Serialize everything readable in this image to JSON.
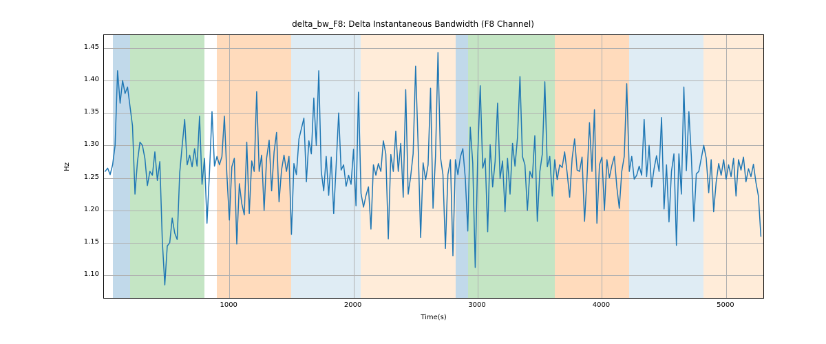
{
  "chart_data": {
    "type": "line",
    "title": "delta_bw_F8: Delta Instantaneous Bandwidth (F8 Channel)",
    "xlabel": "Time(s)",
    "ylabel": "Hz",
    "xlim": [
      -10,
      5300
    ],
    "ylim": [
      1.065,
      1.47
    ],
    "xticks": [
      1000,
      2000,
      3000,
      4000,
      5000
    ],
    "yticks": [
      1.1,
      1.15,
      1.2,
      1.25,
      1.3,
      1.35,
      1.4,
      1.45
    ],
    "bands": [
      {
        "x0": 60,
        "x1": 200,
        "color": "#1f77b4"
      },
      {
        "x0": 200,
        "x1": 800,
        "color": "#2ca02c"
      },
      {
        "x0": 900,
        "x1": 1500,
        "color": "#ff7f0e"
      },
      {
        "x0": 1500,
        "x1": 2060,
        "color": "#1f77b4",
        "alpha": 0.14
      },
      {
        "x0": 2060,
        "x1": 2820,
        "color": "#ffb977"
      },
      {
        "x0": 2820,
        "x1": 2920,
        "color": "#1f77b4"
      },
      {
        "x0": 2920,
        "x1": 3620,
        "color": "#2ca02c"
      },
      {
        "x0": 3620,
        "x1": 4220,
        "color": "#ff7f0e"
      },
      {
        "x0": 4220,
        "x1": 4820,
        "color": "#1f77b4",
        "alpha": 0.14
      },
      {
        "x0": 4820,
        "x1": 5300,
        "color": "#ffb977"
      }
    ],
    "x": [
      0,
      20,
      40,
      60,
      80,
      100,
      120,
      140,
      160,
      180,
      200,
      220,
      240,
      260,
      280,
      300,
      320,
      340,
      360,
      380,
      400,
      420,
      440,
      460,
      480,
      500,
      520,
      540,
      560,
      580,
      600,
      620,
      640,
      660,
      680,
      700,
      720,
      740,
      760,
      780,
      800,
      820,
      840,
      860,
      880,
      900,
      920,
      940,
      960,
      980,
      1000,
      1020,
      1040,
      1060,
      1080,
      1100,
      1120,
      1140,
      1160,
      1180,
      1200,
      1220,
      1240,
      1260,
      1280,
      1300,
      1320,
      1340,
      1360,
      1380,
      1400,
      1420,
      1440,
      1460,
      1480,
      1500,
      1520,
      1540,
      1560,
      1580,
      1600,
      1620,
      1640,
      1660,
      1680,
      1700,
      1720,
      1740,
      1760,
      1780,
      1800,
      1820,
      1840,
      1860,
      1880,
      1900,
      1920,
      1940,
      1960,
      1980,
      2000,
      2020,
      2040,
      2060,
      2080,
      2100,
      2120,
      2140,
      2160,
      2180,
      2200,
      2220,
      2240,
      2260,
      2280,
      2300,
      2320,
      2340,
      2360,
      2380,
      2400,
      2420,
      2440,
      2460,
      2480,
      2500,
      2520,
      2540,
      2560,
      2580,
      2600,
      2620,
      2640,
      2660,
      2680,
      2700,
      2720,
      2740,
      2760,
      2780,
      2800,
      2820,
      2840,
      2860,
      2880,
      2900,
      2920,
      2940,
      2960,
      2980,
      3000,
      3020,
      3040,
      3060,
      3080,
      3100,
      3120,
      3140,
      3160,
      3180,
      3200,
      3220,
      3240,
      3260,
      3280,
      3300,
      3320,
      3340,
      3360,
      3380,
      3400,
      3420,
      3440,
      3460,
      3480,
      3500,
      3520,
      3540,
      3560,
      3580,
      3600,
      3620,
      3640,
      3660,
      3680,
      3700,
      3720,
      3740,
      3760,
      3780,
      3800,
      3820,
      3840,
      3860,
      3880,
      3900,
      3920,
      3940,
      3960,
      3980,
      4000,
      4020,
      4040,
      4060,
      4080,
      4100,
      4120,
      4140,
      4160,
      4180,
      4200,
      4220,
      4240,
      4260,
      4280,
      4300,
      4320,
      4340,
      4360,
      4380,
      4400,
      4420,
      4440,
      4460,
      4480,
      4500,
      4520,
      4540,
      4560,
      4580,
      4600,
      4620,
      4640,
      4660,
      4680,
      4700,
      4720,
      4740,
      4760,
      4780,
      4800,
      4820,
      4840,
      4860,
      4880,
      4900,
      4920,
      4940,
      4960,
      4980,
      5000,
      5020,
      5040,
      5060,
      5080,
      5100,
      5120,
      5140,
      5160,
      5180,
      5200,
      5220,
      5240,
      5260,
      5280
    ],
    "y": [
      1.26,
      1.265,
      1.255,
      1.27,
      1.3,
      1.415,
      1.365,
      1.4,
      1.38,
      1.39,
      1.36,
      1.33,
      1.225,
      1.275,
      1.305,
      1.3,
      1.28,
      1.238,
      1.26,
      1.254,
      1.29,
      1.246,
      1.275,
      1.153,
      1.085,
      1.145,
      1.15,
      1.188,
      1.165,
      1.155,
      1.258,
      1.3,
      1.34,
      1.27,
      1.285,
      1.267,
      1.295,
      1.268,
      1.345,
      1.24,
      1.28,
      1.18,
      1.26,
      1.352,
      1.268,
      1.283,
      1.27,
      1.283,
      1.345,
      1.255,
      1.185,
      1.267,
      1.28,
      1.148,
      1.241,
      1.21,
      1.193,
      1.305,
      1.195,
      1.276,
      1.26,
      1.383,
      1.26,
      1.285,
      1.2,
      1.28,
      1.308,
      1.23,
      1.29,
      1.32,
      1.213,
      1.262,
      1.285,
      1.26,
      1.283,
      1.163,
      1.272,
      1.255,
      1.31,
      1.326,
      1.342,
      1.244,
      1.307,
      1.287,
      1.373,
      1.3,
      1.415,
      1.26,
      1.23,
      1.283,
      1.223,
      1.282,
      1.195,
      1.27,
      1.35,
      1.262,
      1.27,
      1.237,
      1.254,
      1.24,
      1.294,
      1.207,
      1.382,
      1.226,
      1.205,
      1.223,
      1.236,
      1.171,
      1.27,
      1.254,
      1.272,
      1.26,
      1.307,
      1.287,
      1.156,
      1.286,
      1.26,
      1.322,
      1.26,
      1.303,
      1.22,
      1.386,
      1.225,
      1.252,
      1.287,
      1.422,
      1.302,
      1.158,
      1.273,
      1.247,
      1.27,
      1.388,
      1.203,
      1.283,
      1.443,
      1.282,
      1.255,
      1.141,
      1.255,
      1.278,
      1.13,
      1.278,
      1.255,
      1.282,
      1.295,
      1.249,
      1.168,
      1.328,
      1.273,
      1.112,
      1.283,
      1.392,
      1.265,
      1.28,
      1.167,
      1.301,
      1.236,
      1.275,
      1.365,
      1.249,
      1.276,
      1.198,
      1.28,
      1.225,
      1.303,
      1.268,
      1.312,
      1.406,
      1.283,
      1.27,
      1.2,
      1.26,
      1.25,
      1.315,
      1.183,
      1.26,
      1.287,
      1.398,
      1.267,
      1.283,
      1.222,
      1.278,
      1.247,
      1.27,
      1.266,
      1.29,
      1.258,
      1.22,
      1.28,
      1.31,
      1.262,
      1.26,
      1.282,
      1.183,
      1.25,
      1.335,
      1.26,
      1.355,
      1.18,
      1.27,
      1.282,
      1.2,
      1.278,
      1.25,
      1.269,
      1.283,
      1.236,
      1.203,
      1.26,
      1.283,
      1.395,
      1.26,
      1.283,
      1.248,
      1.254,
      1.268,
      1.254,
      1.34,
      1.252,
      1.3,
      1.236,
      1.264,
      1.284,
      1.26,
      1.343,
      1.202,
      1.27,
      1.182,
      1.26,
      1.287,
      1.146,
      1.287,
      1.225,
      1.39,
      1.261,
      1.352,
      1.283,
      1.183,
      1.256,
      1.26,
      1.28,
      1.3,
      1.28,
      1.227,
      1.278,
      1.198,
      1.243,
      1.272,
      1.254,
      1.278,
      1.248,
      1.27,
      1.252,
      1.28,
      1.222,
      1.278,
      1.262,
      1.282,
      1.244,
      1.264,
      1.252,
      1.271,
      1.243,
      1.222,
      1.16
    ]
  }
}
